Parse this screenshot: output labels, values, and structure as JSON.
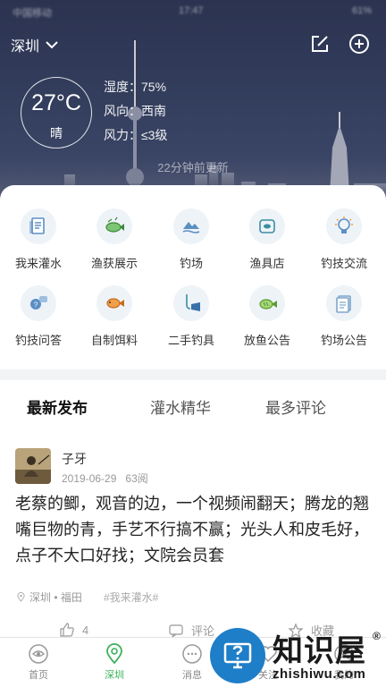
{
  "status_bar": {
    "carrier": "中国移动 ",
    "time": "17:47",
    "battery": "61% "
  },
  "header": {
    "city": "深圳"
  },
  "weather": {
    "temperature": "27°C",
    "condition": "晴",
    "humidity": "湿度：75%",
    "wind_direction": "风向：西南",
    "wind_force": "风力：≤3级",
    "updated": "22分钟前更新"
  },
  "categories": [
    {
      "label": "我来灌水",
      "icon": "document-icon"
    },
    {
      "label": "渔获展示",
      "icon": "fish-catch-icon"
    },
    {
      "label": "钓场",
      "icon": "fishing-spot-icon"
    },
    {
      "label": "渔具店",
      "icon": "tackle-shop-icon"
    },
    {
      "label": "钓技交流",
      "icon": "lightbulb-icon"
    },
    {
      "label": "钓技问答",
      "icon": "qa-chat-icon"
    },
    {
      "label": "自制饵料",
      "icon": "fish-bait-icon"
    },
    {
      "label": "二手钓具",
      "icon": "second-hand-icon"
    },
    {
      "label": "放鱼公告",
      "icon": "fish-release-icon"
    },
    {
      "label": "钓场公告",
      "icon": "notice-icon"
    }
  ],
  "feed": {
    "tabs": [
      {
        "label": "最新发布"
      },
      {
        "label": "灌水精华"
      },
      {
        "label": "最多评论"
      }
    ],
    "post": {
      "author": "子牙",
      "date": "2019-06-29",
      "views": "63阅",
      "text": "老蔡的鲫，观音的边，一个视频闹翻天；腾龙的翘嘴巨物的青，手艺不行搞不赢；光头人和皮毛好，点子不大口好找；文院会员套",
      "location": "深圳 • 福田",
      "tag": "#我来灌水#",
      "likes": "4",
      "comment_label": "评论",
      "favorite_label": "收藏"
    }
  },
  "bottom_nav": [
    {
      "label": "首页"
    },
    {
      "label": "深圳"
    },
    {
      "label": "消息"
    },
    {
      "label": "关注"
    },
    {
      "label": "我的"
    }
  ],
  "watermark": {
    "title": "知识屋",
    "registered": "®",
    "url": "zhishiwu.com"
  },
  "colors": {
    "accent": "#3bb15a",
    "icon_blue": "#5b8fc4",
    "header_bg": "#333d5c"
  }
}
